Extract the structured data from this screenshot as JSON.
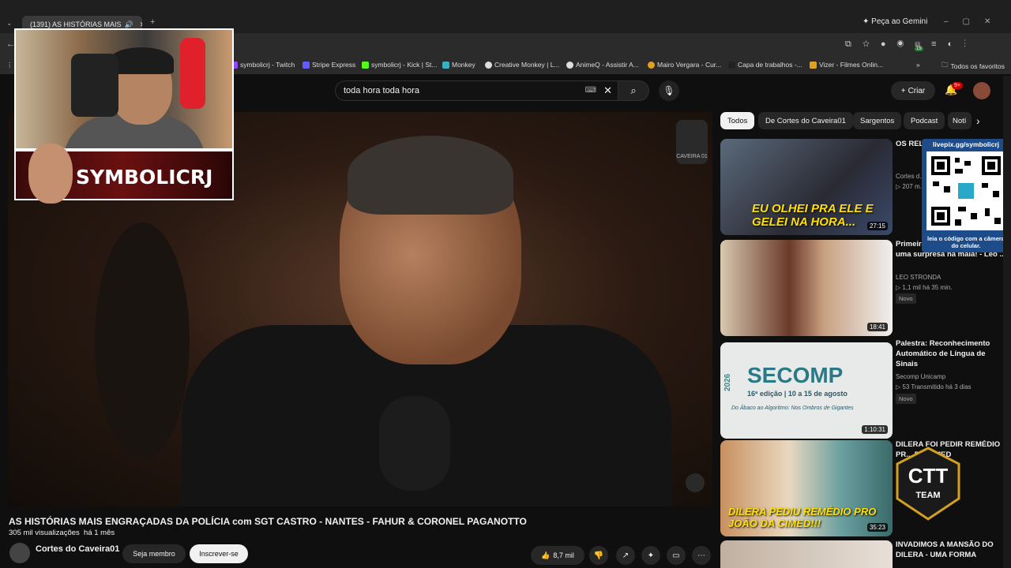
{
  "browser": {
    "tab_title": "(1391) AS HISTÓRIAS MAIS",
    "gemini_label": "Peça ao Gemini",
    "bookmarks": [
      "symbolicrj - Twitch",
      "Stripe Express",
      "symbolicrj - Kick | St...",
      "Monkey",
      "Creative Monkey | L...",
      "AnimeQ - Assistir A...",
      "Mairo Vergara - Cur...",
      "Capa de trabalhos -...",
      "Vizer - Filmes Onlin..."
    ],
    "all_favorites": "Todos os favoritos",
    "ext_badge": "19"
  },
  "header": {
    "search_value": "toda hora toda hora",
    "create_label": "Criar",
    "notif_count": "9+"
  },
  "video": {
    "channel_logo_text": "CAVEIRA 01",
    "title": "AS HISTÓRIAS MAIS ENGRAÇADAS DA POLÍCIA com SGT CASTRO - NANTES - FAHUR & CORONEL PAGANOTTO",
    "views": "305 mil visualizações",
    "age": "há 1 mês",
    "owner": "Cortes do Caveira01",
    "join_label": "Seja membro",
    "subscribe_label": "Inscrever-se",
    "likes": "8,7 mil"
  },
  "chips": [
    "Todos",
    "De Cortes do Caveira01",
    "Sargentos",
    "Podcast",
    "Notí"
  ],
  "recommendations": [
    {
      "title": "OS REL... ABSUR... CORON...",
      "channel": "Cortes d...",
      "stats": "207 m...",
      "duration": "27:15",
      "thumb_text": "EU OLHEI PRA ELE E GELEI NA HORA..."
    },
    {
      "title": "Primeir... lugares incríveis e uma surpresa na mala! - Leo ...",
      "channel": "LEO STRONDA",
      "stats": "1,1 mil  há 35 min.",
      "badge": "Novo",
      "duration": "18:41"
    },
    {
      "title": "Palestra: Reconhecimento Automático de Língua de Sinais",
      "channel": "Secomp Unicamp",
      "stats": "53  Transmitido há 3 dias",
      "badge": "Novo",
      "duration": "1:10:31",
      "thumb_title": "SECOMP",
      "thumb_year": "2026",
      "thumb_sub": "16ª edição | 10 a 15 de agosto",
      "thumb_tag": "Do Ábaco ao Algoritmo: Nos Ombros de Gigantes"
    },
    {
      "title": "DILERA FOI PEDIR REMÉDIO PR... DA CIMED",
      "duration": "35:23",
      "thumb_text": "DILERA PEDIU REMÉDIO PRO JOÃO DA CIMED!!!"
    },
    {
      "title": "INVADIMOS A MANSÃO DO DILERA - UMA FORMA"
    }
  ],
  "overlays": {
    "streamer_name": "SYMBOLICRJ",
    "qr_url": "livepix.gg/symbolicrj",
    "qr_caption": "leia o código com a câmera do celular.",
    "ctt_text": "CTT",
    "ctt_sub": "TEAM"
  }
}
